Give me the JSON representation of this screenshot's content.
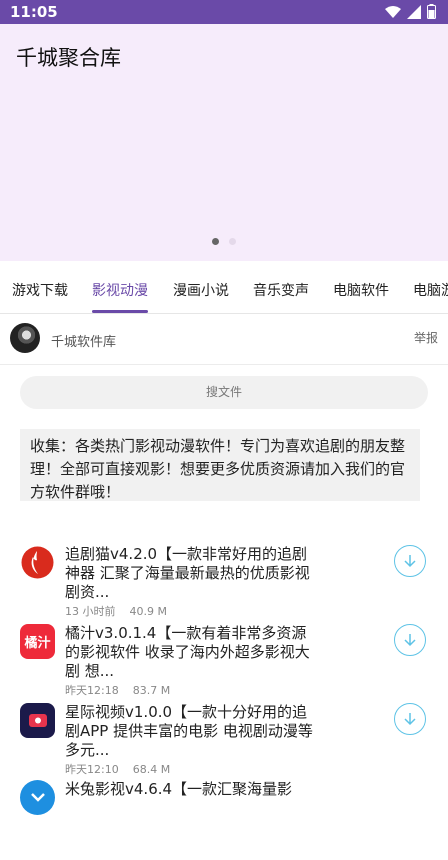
{
  "status_bar": {
    "time": "11:05",
    "icons": [
      "wifi-icon",
      "signal-icon",
      "battery-icon"
    ]
  },
  "header": {
    "title": "千城聚合库"
  },
  "carousel": {
    "pages": 2,
    "active_index": 0
  },
  "tabs": [
    {
      "label": "游戏下载",
      "active": false
    },
    {
      "label": "影视动漫",
      "active": true
    },
    {
      "label": "漫画小说",
      "active": false
    },
    {
      "label": "音乐变声",
      "active": false
    },
    {
      "label": "电脑软件",
      "active": false
    },
    {
      "label": "电脑游",
      "active": false
    }
  ],
  "author": {
    "name": "千城软件库",
    "report": "举报"
  },
  "search": {
    "placeholder": "搜文件"
  },
  "description": "收集：各类热门影视动漫软件！专门为喜欢追剧的朋友整理！全部可直接观影！想要更多优质资源请加入我们的官方软件群哦！",
  "files": [
    {
      "icon": "flame-app-icon",
      "icon_color": "#d92b1d",
      "icon_text": "",
      "title": "追剧猫v4.2.0【一款非常好用的追剧神器 汇聚了海量最新最热的优质影视剧资...",
      "time": "13 小时前",
      "size": "40.9 M"
    },
    {
      "icon": "juzi-app-icon",
      "icon_color": "#ee2a3a",
      "icon_text": "橘汁",
      "title": "橘汁v3.0.1.4【一款有着非常多资源的影视软件 收录了海内外超多影视大剧 想...",
      "time": "昨天12:18",
      "size": "83.7 M"
    },
    {
      "icon": "tv-app-icon",
      "icon_color": "#1b1a4a",
      "icon_text": "",
      "title": "星际视频v1.0.0【一款十分好用的追剧APP 提供丰富的电影 电视剧动漫等多元...",
      "time": "昨天12:10",
      "size": "68.4 M"
    },
    {
      "icon": "rabbit-app-icon",
      "icon_color": "#1e8fe0",
      "icon_text": "",
      "title": "米兔影视v4.6.4【一款汇聚海量影",
      "time": "",
      "size": ""
    }
  ],
  "colors": {
    "accent": "#6a4aa8",
    "download": "#5ec3e6",
    "hero_bg": "#f6ecfb"
  }
}
